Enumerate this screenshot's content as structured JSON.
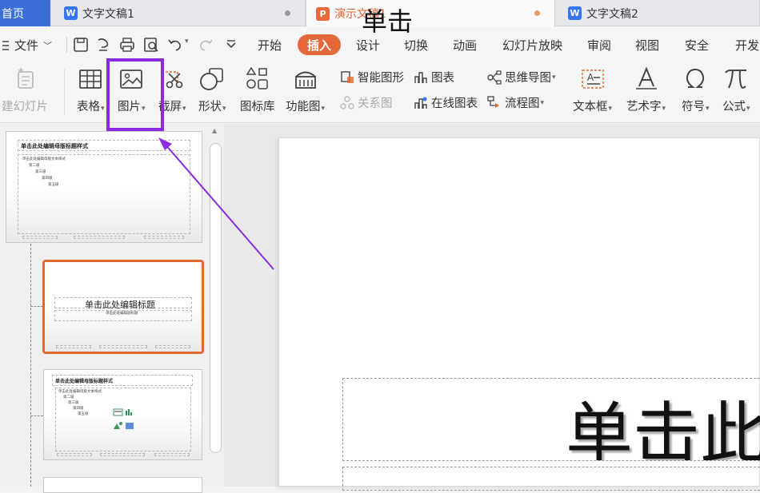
{
  "tabs": {
    "home": "首页",
    "doc1": "文字文稿1",
    "pres1": "演示文稿1",
    "doc2": "文字文稿2",
    "doc_icon": "W",
    "pres_icon": "P"
  },
  "menu": {
    "file": "文件",
    "items": [
      "开始",
      "插入",
      "设计",
      "切换",
      "动画",
      "幻灯片放映",
      "审阅",
      "视图",
      "安全",
      "开发"
    ]
  },
  "ribbon": {
    "new_slide": "建幻灯片",
    "table": "表格",
    "picture": "图片",
    "screenshot": "截屏",
    "shape": "形状",
    "icon_lib": "图标库",
    "func_chart": "功能图",
    "smart_art": "智能图形",
    "chart": "图表",
    "relation": "关系图",
    "online_chart": "在线图表",
    "mindmap": "思维导图",
    "flowchart": "流程图",
    "textbox": "文本框",
    "wordart": "艺术字",
    "symbol": "符号",
    "formula": "公式",
    "caret": "▾"
  },
  "thumbnails": {
    "master_title": "单击此处编辑母版标题样式",
    "master_text": "单击此处编辑母版文本样式",
    "level2": "第二级",
    "level3": "第三级",
    "level4": "第四级",
    "level5": "第五级",
    "title_layout_title": "单击此处编辑标题",
    "title_layout_sub": "单击此处编辑副标题",
    "content_title": "单击此处编辑母版标题样式"
  },
  "slide": {
    "title_partial": "单击此",
    "subtitle_partial": "单击"
  },
  "colors": {
    "accent": "#e5683b",
    "highlight": "#8a2be2",
    "home_tab": "#3b6fd8"
  }
}
